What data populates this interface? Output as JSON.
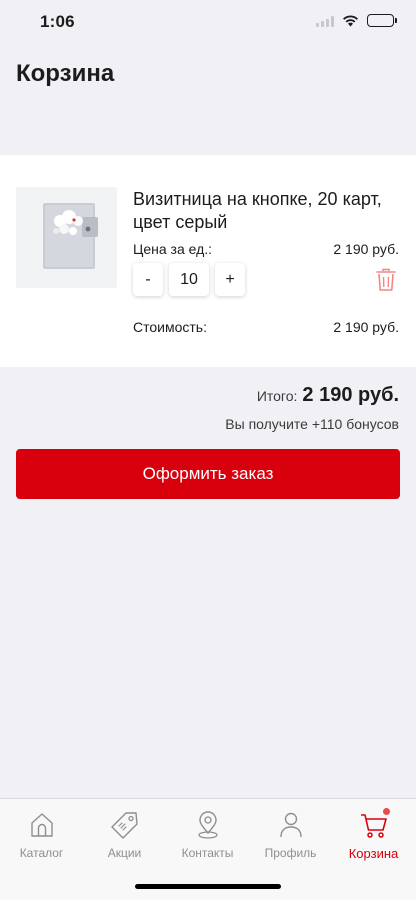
{
  "status_bar": {
    "time": "1:06"
  },
  "header": {
    "title": "Корзина"
  },
  "cart_item": {
    "name": "Визитница на кнопке, 20 карт, цвет серый",
    "unit_price_label": "Цена за ед.:",
    "unit_price": "2 190 руб.",
    "decrement_label": "-",
    "quantity": "10",
    "increment_label": "+",
    "cost_label": "Стоимость:",
    "cost": "2 190 руб.",
    "delete_icon": "trash-icon"
  },
  "summary": {
    "total_label": "Итого:",
    "total_value": "2 190 руб.",
    "bonus_text": "Вы получите +110 бонусов"
  },
  "checkout": {
    "label": "Оформить заказ",
    "color": "#d9000d"
  },
  "tab_bar": {
    "items": [
      {
        "label": "Каталог",
        "icon": "home-icon",
        "active": false
      },
      {
        "label": "Акции",
        "icon": "tag-icon",
        "active": false
      },
      {
        "label": "Контакты",
        "icon": "location-pin-icon",
        "active": false
      },
      {
        "label": "Профиль",
        "icon": "person-icon",
        "active": false
      },
      {
        "label": "Корзина",
        "icon": "cart-icon",
        "active": true
      }
    ],
    "active_color": "#d9000d",
    "inactive_color": "#8e8e93"
  }
}
